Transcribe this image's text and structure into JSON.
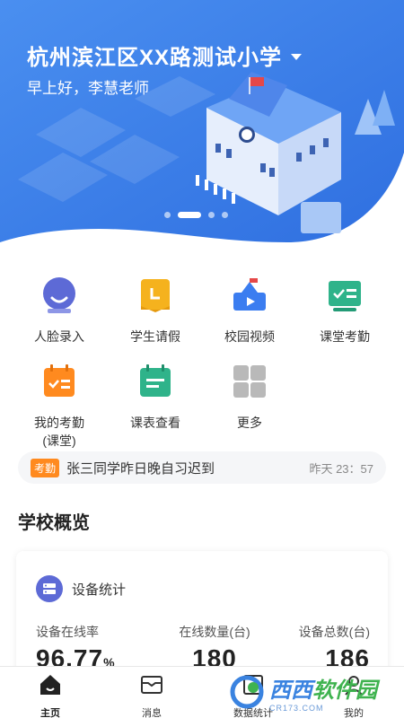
{
  "header": {
    "school_name": "杭州滨江区XX路测试小学",
    "greeting": "早上好，李慧老师"
  },
  "menu": {
    "items": [
      {
        "label": "人脸录入",
        "icon": "face-icon"
      },
      {
        "label": "学生请假",
        "icon": "leave-icon"
      },
      {
        "label": "校园视频",
        "icon": "video-icon"
      },
      {
        "label": "课堂考勤",
        "icon": "class-attendance-icon"
      },
      {
        "label": "我的考勤\n(课堂)",
        "icon": "my-attendance-icon"
      },
      {
        "label": "课表查看",
        "icon": "schedule-icon"
      },
      {
        "label": "更多",
        "icon": "more-grid-icon"
      }
    ]
  },
  "notice": {
    "tag": "考勤",
    "text": "张三同学昨日晚自习迟到",
    "time": "昨天 23：57"
  },
  "overview": {
    "title": "学校概览"
  },
  "device_card": {
    "title": "设备统计",
    "stats": [
      {
        "label": "设备在线率",
        "value": "96.77",
        "unit": "%"
      },
      {
        "label": "在线数量(台)",
        "value": "180"
      },
      {
        "label": "设备总数(台)",
        "value": "186"
      }
    ]
  },
  "tabbar": {
    "tabs": [
      {
        "label": "主页",
        "icon": "home-icon"
      },
      {
        "label": "消息",
        "icon": "message-icon"
      },
      {
        "label": "数据统计",
        "icon": "stats-icon"
      },
      {
        "label": "我的",
        "icon": "profile-icon"
      }
    ]
  },
  "watermark": {
    "text_a": "西西",
    "text_b": "软件园",
    "sub": "CR173.COM"
  },
  "colors": {
    "primary": "#3b82f6",
    "orange": "#ff8a1f",
    "green": "#2fb38a",
    "purple": "#5d6ad6"
  }
}
